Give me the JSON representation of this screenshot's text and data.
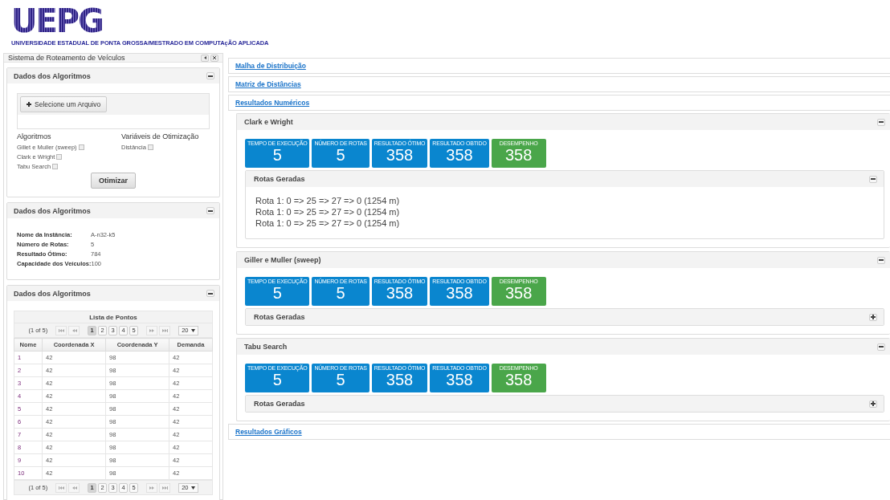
{
  "header": {
    "logo": "UEPG",
    "subtitle": "UNIVERSIDADE ESTADUAL DE PONTA GROSSA/MESTRADO EM COMPUTAçÃO APLICADA"
  },
  "sidebar": {
    "title": "Sistema de Roteamento de Veículos",
    "form_panel": {
      "title": "Dados dos Algoritmos",
      "expanded": true,
      "upload_button": "Selecione um Arquivo",
      "algorithms_label": "Algoritmos",
      "algorithms": [
        {
          "label": "Gillet e Muller (sweep)",
          "checked": false
        },
        {
          "label": "Clark e Wright",
          "checked": false
        },
        {
          "label": "Tabu Search",
          "checked": false
        }
      ],
      "variables_label": "Variáveis de Otimização",
      "variables": [
        {
          "label": "Distância",
          "checked": false
        }
      ],
      "submit": "Otimizar"
    },
    "info_panel": {
      "title": "Dados dos Algoritmos",
      "expanded": true,
      "fields": [
        {
          "label": "Nome da Instância:",
          "value": "A-n32-k5"
        },
        {
          "label": "Número de Rotas:",
          "value": "5"
        },
        {
          "label": "Resultado Ótimo:",
          "value": "784"
        },
        {
          "label": "Capacidade dos Veículos:",
          "value": "100"
        }
      ]
    },
    "table_panel": {
      "title": "Dados dos Algoritmos",
      "expanded": true,
      "caption": "Lista de Pontos",
      "paginator_top": {
        "summary": "(1 of 5)",
        "pages": [
          {
            "label": "1",
            "selected": true
          },
          {
            "label": "2",
            "selected": false
          },
          {
            "label": "3",
            "selected": false
          },
          {
            "label": "4",
            "selected": false
          },
          {
            "label": "5",
            "selected": false
          }
        ],
        "rows_per_page": "20"
      },
      "columns": [
        "Nome",
        "Coordenada X",
        "Coordenada Y",
        "Demanda"
      ],
      "rows": [
        [
          "1",
          "42",
          "98",
          "42"
        ],
        [
          "2",
          "42",
          "98",
          "42"
        ],
        [
          "3",
          "42",
          "98",
          "42"
        ],
        [
          "4",
          "42",
          "98",
          "42"
        ],
        [
          "5",
          "42",
          "98",
          "42"
        ],
        [
          "6",
          "42",
          "98",
          "42"
        ],
        [
          "7",
          "42",
          "98",
          "42"
        ],
        [
          "8",
          "42",
          "98",
          "42"
        ],
        [
          "9",
          "42",
          "98",
          "42"
        ],
        [
          "10",
          "42",
          "98",
          "42"
        ]
      ],
      "paginator_bottom": {
        "summary": "(1 of 5)",
        "pages": [
          {
            "label": "1",
            "selected": true
          },
          {
            "label": "2",
            "selected": false
          },
          {
            "label": "3",
            "selected": false
          },
          {
            "label": "4",
            "selected": false
          },
          {
            "label": "5",
            "selected": false
          }
        ],
        "rows_per_page": "20"
      }
    }
  },
  "main": {
    "links_top": [
      "Malha de Distribuição",
      "Matriz de Distâncias",
      "Resultados Numéricos"
    ],
    "results": [
      {
        "title": "Clark e Wright",
        "expanded": true,
        "tiles": [
          {
            "label": "TEMPO DE EXECUÇÃO",
            "value": "5",
            "color": "#0a86cf"
          },
          {
            "label": "NÚMERO DE ROTAS",
            "value": "5",
            "color": "#0a86cf"
          },
          {
            "label": "RESULTADO ÓTIMO",
            "value": "358",
            "color": "#0a86cf"
          },
          {
            "label": "RESULTADO OBTIDO",
            "value": "358",
            "color": "#0a86cf"
          },
          {
            "label": "DESEMPENHO",
            "value": "358",
            "color": "#4aa64a"
          }
        ],
        "routes_panel": {
          "title": "Rotas Geradas",
          "expanded": true,
          "routes": [
            "Rota 1: 0 => 25 => 27 => 0 (1254 m)",
            "Rota 1: 0 => 25 => 27 => 0 (1254 m)",
            "Rota 1: 0 => 25 => 27 => 0 (1254 m)"
          ]
        }
      },
      {
        "title": "Giller e Muller (sweep)",
        "expanded": true,
        "tiles": [
          {
            "label": "TEMPO DE EXECUÇÃO",
            "value": "5",
            "color": "#0a86cf"
          },
          {
            "label": "NÚMERO DE ROTAS",
            "value": "5",
            "color": "#0a86cf"
          },
          {
            "label": "RESULTADO ÓTIMO",
            "value": "358",
            "color": "#0a86cf"
          },
          {
            "label": "RESULTADO OBTIDO",
            "value": "358",
            "color": "#0a86cf"
          },
          {
            "label": "DESEMPENHO",
            "value": "358",
            "color": "#4aa64a"
          }
        ],
        "routes_panel": {
          "title": "Rotas Geradas",
          "expanded": false
        }
      },
      {
        "title": "Tabu Search",
        "expanded": true,
        "tiles": [
          {
            "label": "TEMPO DE EXECUÇÃO",
            "value": "5",
            "color": "#0a86cf"
          },
          {
            "label": "NÚMERO DE ROTAS",
            "value": "5",
            "color": "#0a86cf"
          },
          {
            "label": "RESULTADO ÓTIMO",
            "value": "358",
            "color": "#0a86cf"
          },
          {
            "label": "RESULTADO OBTIDO",
            "value": "358",
            "color": "#0a86cf"
          },
          {
            "label": "DESEMPENHO",
            "value": "358",
            "color": "#4aa64a"
          }
        ],
        "routes_panel": {
          "title": "Rotas Geradas",
          "expanded": false
        }
      }
    ],
    "links_bottom": [
      "Resultados Gráficos"
    ]
  }
}
